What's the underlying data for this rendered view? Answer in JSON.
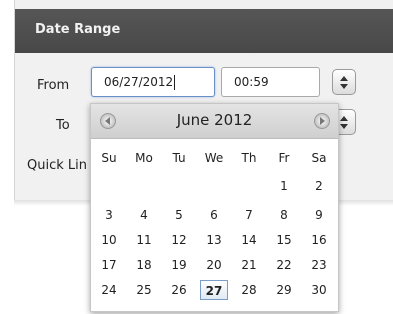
{
  "panel": {
    "title": "Date Range"
  },
  "form": {
    "from_label": "From",
    "to_label": "To",
    "quick_links_label": "Quick Lin",
    "from_date": "06/27/2012",
    "from_time": "00:59"
  },
  "calendar": {
    "month_label": "June 2012",
    "weekdays": [
      "Su",
      "Mo",
      "Tu",
      "We",
      "Th",
      "Fr",
      "Sa"
    ],
    "weeks": [
      [
        "",
        "",
        "",
        "",
        "",
        "1",
        "2"
      ],
      [
        "3",
        "4",
        "5",
        "6",
        "7",
        "8",
        "9"
      ],
      [
        "10",
        "11",
        "12",
        "13",
        "14",
        "15",
        "16"
      ],
      [
        "17",
        "18",
        "19",
        "20",
        "21",
        "22",
        "23"
      ],
      [
        "24",
        "25",
        "26",
        "27",
        "28",
        "29",
        "30"
      ]
    ],
    "selected_day": "27"
  },
  "colors": {
    "header_bg": "#4f4f4f",
    "panel_bg": "#f1f1f1",
    "highlight_border": "#7a9cc6"
  }
}
